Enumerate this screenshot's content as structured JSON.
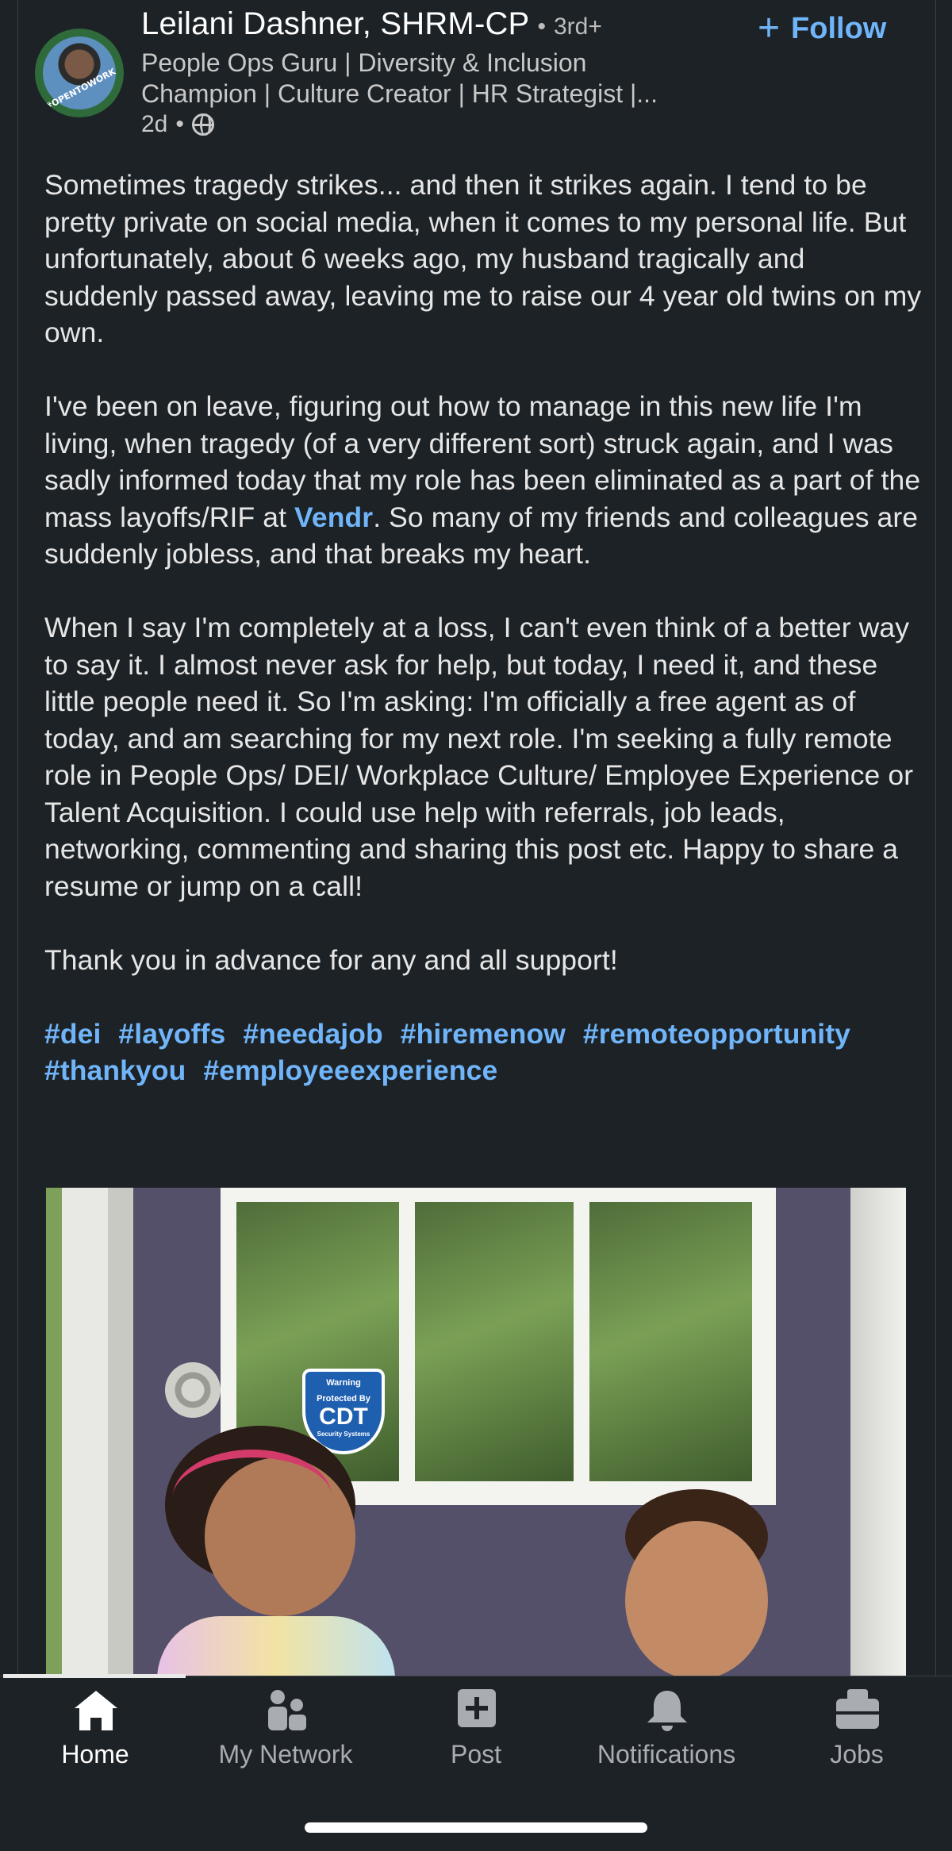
{
  "author": {
    "name": "Leilani Dashner, SHRM-CP",
    "separator": "•",
    "degree": "3rd+",
    "headline_line1": "People Ops Guru | Diversity & Inclusion",
    "headline_line2": "Champion | Culture Creator | HR Strategist |...",
    "posted": "2d",
    "avatar_badge": "#OPENTOWORK"
  },
  "follow": {
    "plus": "+",
    "label": "Follow"
  },
  "post": {
    "p1": "Sometimes tragedy strikes... and then it strikes again.  I tend to be pretty private on social media, when it comes to my personal life.  But unfortunately, about 6 weeks ago, my husband tragically and suddenly passed away, leaving me to raise our 4 year old twins on my own.",
    "p2_before": "I've been on leave, figuring out how to manage in this new life I'm living, when tragedy (of a very different sort) struck again, and I was sadly informed today that my role has been eliminated as a part of the mass layoffs/RIF at ",
    "p2_link": "Vendr",
    "p2_after": ".  So many of my friends and colleagues are suddenly jobless, and that breaks my heart.",
    "p3": "When I say I'm completely at a loss, I can't even think of a better way to say it.  I almost never ask for help, but today, I need it, and these little people need it.  So I'm asking: I'm officially a free agent as of today, and am searching for my next role.  I'm seeking a fully remote role in People Ops/ DEI/ Workplace Culture/ Employee Experience or Talent Acquisition.  I could use help with referrals, job leads, networking, commenting and sharing this post etc.  Happy to share a resume or jump on a call!",
    "p4": "Thank you in advance for any and all support!",
    "hashtags": [
      "#dei",
      "#layoffs",
      "#needajob",
      "#hiremenow",
      "#remoteopportunity",
      "#thankyou",
      "#employeeexperience"
    ]
  },
  "photo": {
    "sticker_line1": "Warning",
    "sticker_line2": "Protected By",
    "sticker_brand": "CDT",
    "sticker_line3": "Security Systems"
  },
  "tabs": [
    {
      "label": "Home",
      "icon": "home-icon",
      "active": true
    },
    {
      "label": "My Network",
      "icon": "network-icon"
    },
    {
      "label": "Post",
      "icon": "post-icon"
    },
    {
      "label": "Notifications",
      "icon": "bell-icon"
    },
    {
      "label": "Jobs",
      "icon": "briefcase-icon"
    }
  ],
  "colors": {
    "background": "#1d2226",
    "link": "#70b5f9",
    "text": "#e6e6e6"
  }
}
